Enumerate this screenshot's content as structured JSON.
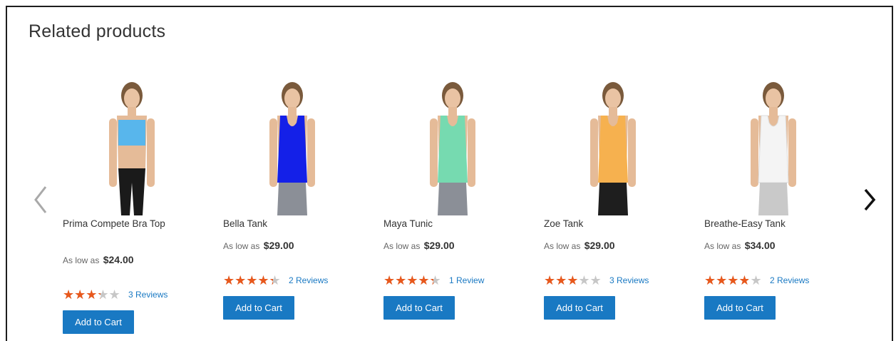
{
  "section": {
    "title": "Related products"
  },
  "colors": {
    "accent": "#1979c3",
    "star": "#e8581c",
    "star_empty": "#c7c7c7"
  },
  "nav": {
    "prev_icon": "chevron-left-icon",
    "next_icon": "chevron-right-icon"
  },
  "products": [
    {
      "name": "Prima Compete Bra Top",
      "price_prefix": "As low as",
      "price": "$24.00",
      "rating_pct": 60,
      "reviews": "3 Reviews",
      "cta": "Add to Cart",
      "top_color": "#58b6ec"
    },
    {
      "name": "Bella Tank",
      "price_prefix": "As low as",
      "price": "$29.00",
      "rating_pct": 80,
      "reviews": "2 Reviews",
      "cta": "Add to Cart",
      "top_color": "#1420e8"
    },
    {
      "name": "Maya Tunic",
      "price_prefix": "As low as",
      "price": "$29.00",
      "rating_pct": 80,
      "reviews": "1 Review",
      "cta": "Add to Cart",
      "top_color": "#76dab0"
    },
    {
      "name": "Zoe Tank",
      "price_prefix": "As low as",
      "price": "$29.00",
      "rating_pct": 53,
      "reviews": "3 Reviews",
      "cta": "Add to Cart",
      "top_color": "#f6b14f"
    },
    {
      "name": "Breathe-Easy Tank",
      "price_prefix": "As low as",
      "price": "$34.00",
      "rating_pct": 70,
      "reviews": "2 Reviews",
      "cta": "Add to Cart",
      "top_color": "#f4f4f4"
    }
  ]
}
